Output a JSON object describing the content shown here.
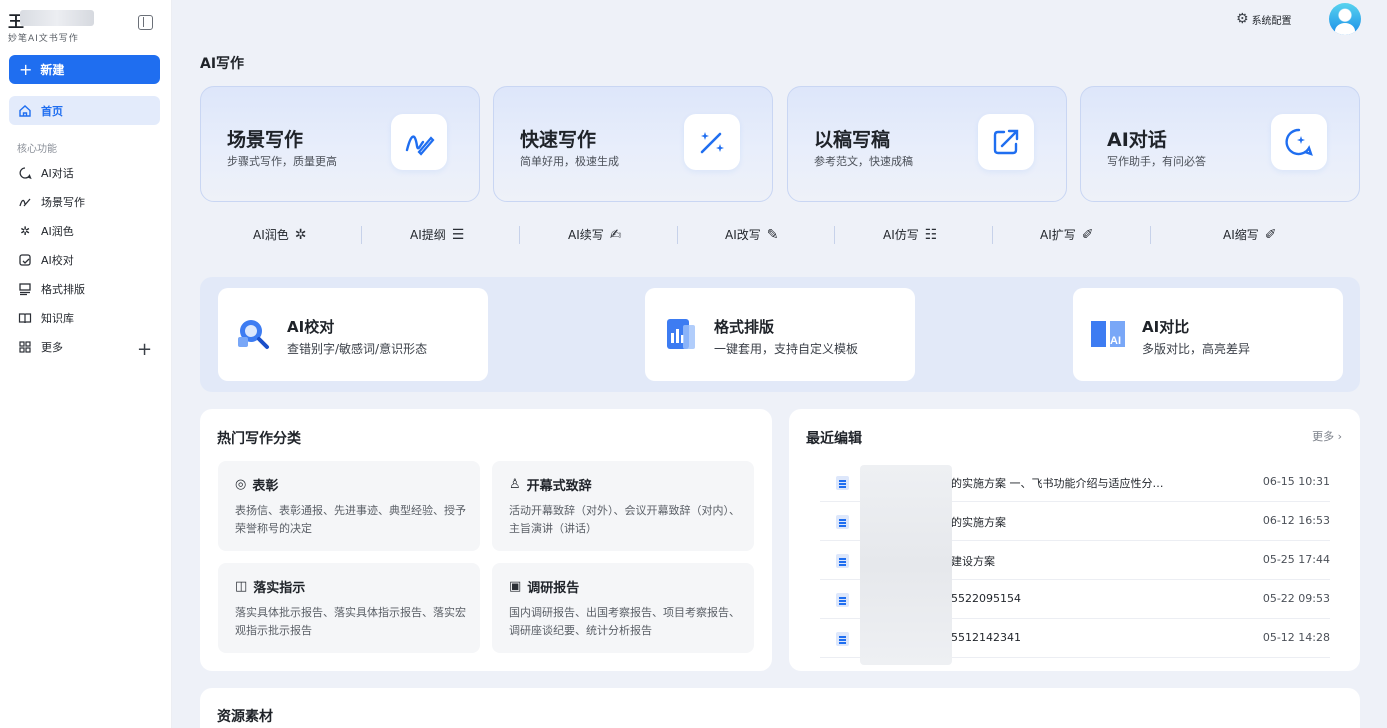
{
  "brand": {
    "name": "王",
    "subtitle": "妙笔AI文书写作"
  },
  "sidebar": {
    "new_label": "新建",
    "home_label": "首页",
    "group_title": "核心功能",
    "items": [
      {
        "label": "AI对话",
        "icon": "chat-icon"
      },
      {
        "label": "场景写作",
        "icon": "pen-icon"
      },
      {
        "label": "AI润色",
        "icon": "sparkle-icon"
      },
      {
        "label": "AI校对",
        "icon": "proofread-icon"
      },
      {
        "label": "格式排版",
        "icon": "layout-icon"
      },
      {
        "label": "知识库",
        "icon": "book-icon"
      },
      {
        "label": "更多",
        "icon": "grid-icon"
      }
    ]
  },
  "header": {
    "system_config": "系统配置"
  },
  "main": {
    "section_title": "AI写作",
    "big_cards": [
      {
        "title": "场景写作",
        "subtitle": "步骤式写作，质量更高",
        "icon": "signature-icon"
      },
      {
        "title": "快速写作",
        "subtitle": "简单好用，极速生成",
        "icon": "magic-wand-icon"
      },
      {
        "title": "以稿写稿",
        "subtitle": "参考范文，快速成稿",
        "icon": "external-link-icon"
      },
      {
        "title": "AI对话",
        "subtitle": "写作助手，有问必答",
        "icon": "chat-sparkle-icon"
      }
    ],
    "tools": [
      {
        "label": "AI润色",
        "icon": "sparkle-icon"
      },
      {
        "label": "AI提纲",
        "icon": "outline-icon"
      },
      {
        "label": "AI续写",
        "icon": "continue-icon"
      },
      {
        "label": "AI改写",
        "icon": "edit-icon"
      },
      {
        "label": "AI仿写",
        "icon": "imitate-icon"
      },
      {
        "label": "AI扩写",
        "icon": "expand-icon"
      },
      {
        "label": "AI缩写",
        "icon": "shrink-icon"
      }
    ],
    "features": [
      {
        "title": "AI校对",
        "subtitle": "查错别字/敏感词/意识形态",
        "icon": "magnifier-icon"
      },
      {
        "title": "格式排版",
        "subtitle": "一键套用，支持自定义模板",
        "icon": "chart-doc-icon"
      },
      {
        "title": "AI对比",
        "subtitle": "多版对比，高亮差异",
        "icon": "compare-icon"
      }
    ],
    "hot": {
      "title": "热门写作分类",
      "categories": [
        {
          "title": "表彰",
          "desc": "表扬信、表彰通报、先进事迹、典型经验、授予荣誉称号的决定",
          "icon": "medal-icon"
        },
        {
          "title": "开幕式致辞",
          "desc": "活动开幕致辞（对外）、会议开幕致辞（对内）、主旨演讲（讲话）",
          "icon": "people-icon"
        },
        {
          "title": "落实指示",
          "desc": "落实具体批示报告、落实具体指示报告、落实宏观指示批示报告",
          "icon": "comment-icon"
        },
        {
          "title": "调研报告",
          "desc": "国内调研报告、出国考察报告、项目考察报告、调研座谈纪要、统计分析报告",
          "icon": "report-icon"
        }
      ]
    },
    "recent": {
      "title": "最近编辑",
      "more_label": "更多 ›",
      "items": [
        {
          "name": "的实施方案 一、飞书功能介绍与适应性分…",
          "time": "06-15 10:31"
        },
        {
          "name": "的实施方案",
          "time": "06-12 16:53"
        },
        {
          "name": "建设方案",
          "time": "05-25 17:44"
        },
        {
          "name": "5522095154",
          "time": "05-22 09:53"
        },
        {
          "name": "5512142341",
          "time": "05-12 14:28"
        }
      ]
    },
    "resources": {
      "title": "资源素材"
    }
  },
  "colors": {
    "accent": "#1f6ef0",
    "background": "#eef1f8"
  }
}
